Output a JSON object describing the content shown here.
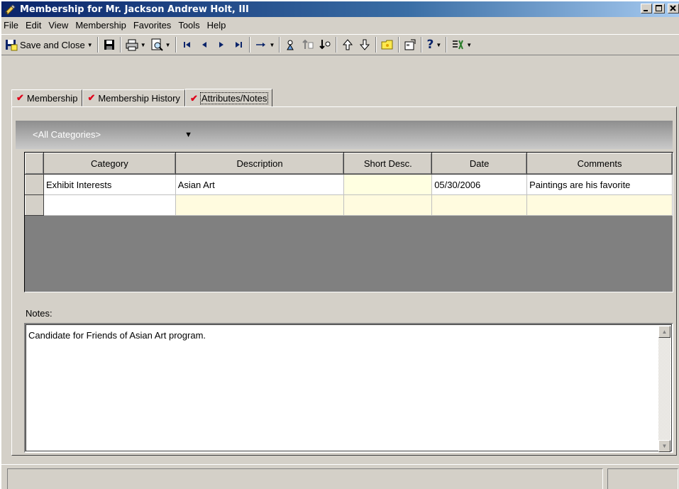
{
  "window": {
    "title": "Membership for Mr. Jackson Andrew Holt, III",
    "accent": "#0a246a",
    "face_color": "#d4d0c8"
  },
  "menu": [
    "File",
    "Edit",
    "View",
    "Membership",
    "Favorites",
    "Tools",
    "Help"
  ],
  "toolbar": {
    "save_and_close": "Save and Close",
    "icons": [
      "save-icon",
      "print-icon",
      "print-preview-icon",
      "first-record-icon",
      "previous-record-icon",
      "next-record-icon",
      "last-record-icon",
      "go-to-icon",
      "query-icon",
      "import-icon",
      "export-icon",
      "move-up-icon",
      "move-down-icon",
      "folder-icon",
      "properties-icon",
      "help-icon",
      "tools-icon"
    ]
  },
  "tabs": [
    {
      "label": "Membership",
      "checked": true,
      "active": false
    },
    {
      "label": "Membership History",
      "checked": true,
      "active": false
    },
    {
      "label": "Attributes/Notes",
      "checked": true,
      "active": true
    }
  ],
  "category_filter": "<All Categories>",
  "grid": {
    "columns": [
      "Category",
      "Description",
      "Short Desc.",
      "Date",
      "Comments"
    ],
    "rows": [
      [
        "Exhibit Interests",
        "Asian Art",
        "",
        "05/30/2006",
        "Paintings are his favorite"
      ],
      [
        "",
        "",
        "",
        "",
        ""
      ]
    ]
  },
  "notes": {
    "label": "Notes:",
    "text": "Candidate for Friends of Asian Art program."
  }
}
